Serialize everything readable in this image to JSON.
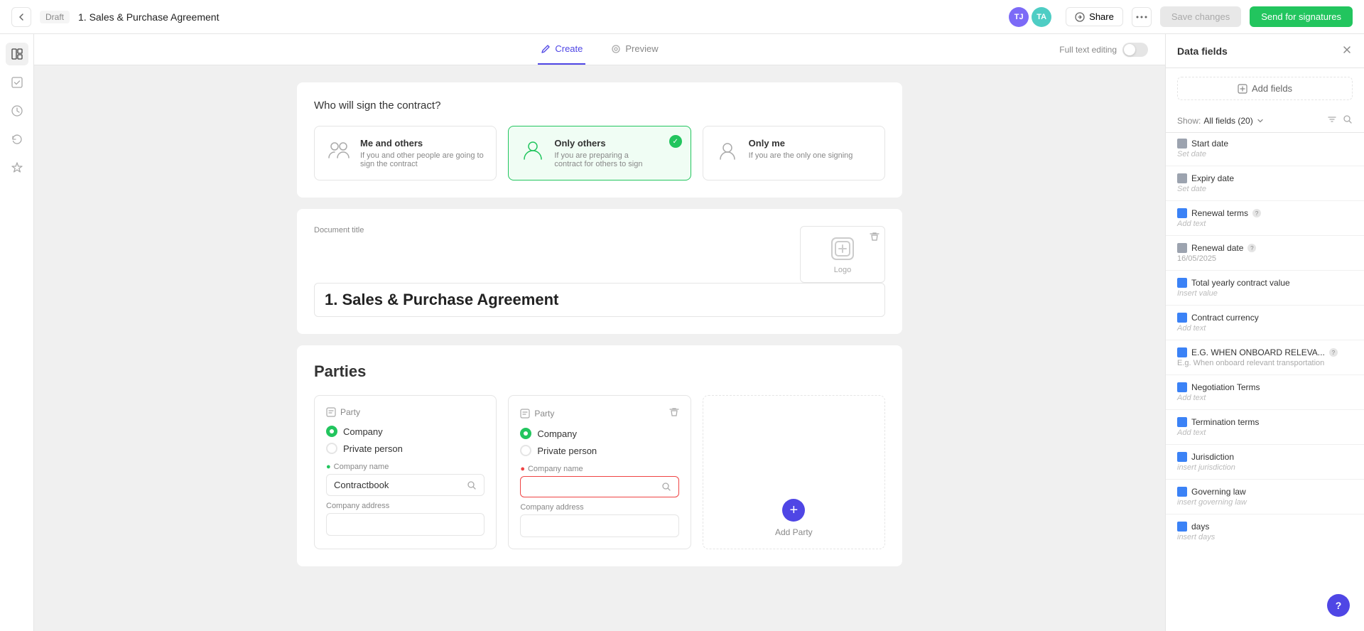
{
  "topbar": {
    "back_label": "←",
    "draft_label": "Draft",
    "title": "1. Sales & Purchase Agreement",
    "avatar1_initials": "TJ",
    "avatar2_initials": "TA",
    "share_label": "Share",
    "save_label": "Save changes",
    "send_label": "Send for signatures"
  },
  "tabs": {
    "create_label": "Create",
    "preview_label": "Preview",
    "full_text_label": "Full text editing"
  },
  "sign_section": {
    "question": "Who will sign the contract?",
    "option1_title": "Me and others",
    "option1_desc": "If you and other people are going to sign the contract",
    "option2_title": "Only others",
    "option2_desc": "If you are preparing a contract for others to sign",
    "option3_title": "Only me",
    "option3_desc": "If you are the only one signing"
  },
  "document": {
    "title_label": "Document title",
    "title_value": "1. Sales & Purchase Agreement",
    "logo_label": "Logo"
  },
  "parties": {
    "heading": "Parties",
    "party1": {
      "label": "Party",
      "company_label": "Company",
      "private_label": "Private person",
      "company_name_label": "Company name",
      "company_name_value": "Contractbook",
      "address_label": "Company address"
    },
    "party2": {
      "label": "Party",
      "company_label": "Company",
      "private_label": "Private person",
      "company_name_label": "Company name",
      "company_name_value": "",
      "address_label": "Company address"
    },
    "add_party_label": "Add Party"
  },
  "right_panel": {
    "title": "Data fields",
    "add_fields_label": "Add fields",
    "show_label": "Show:",
    "filter_label": "All fields (20)",
    "fields": [
      {
        "name": "Start date",
        "value": "Set date",
        "icon": "gray",
        "is_placeholder": true
      },
      {
        "name": "Expiry date",
        "value": "Set date",
        "icon": "gray",
        "is_placeholder": true
      },
      {
        "name": "Renewal terms",
        "value": "Add text",
        "icon": "blue",
        "is_placeholder": true,
        "has_help": true
      },
      {
        "name": "Renewal date",
        "value": "16/05/2025",
        "icon": "gray",
        "is_placeholder": false,
        "has_help": true
      },
      {
        "name": "Total yearly contract value",
        "value": "Insert value",
        "icon": "blue",
        "is_placeholder": true
      },
      {
        "name": "Contract currency",
        "value": "Add text",
        "icon": "blue",
        "is_placeholder": true
      },
      {
        "name": "E.G. WHEN ONBOARD RELEVA...",
        "value": "E.g. When onboard relevant transportation",
        "icon": "blue",
        "is_placeholder": false,
        "has_help": true
      },
      {
        "name": "Negotiation Terms",
        "value": "Add text",
        "icon": "blue",
        "is_placeholder": true
      },
      {
        "name": "Termination terms",
        "value": "Add text",
        "icon": "blue",
        "is_placeholder": true
      },
      {
        "name": "Jurisdiction",
        "value": "insert jurisdiction",
        "icon": "blue",
        "is_placeholder": true
      },
      {
        "name": "Governing law",
        "value": "insert governing law",
        "icon": "blue",
        "is_placeholder": true
      },
      {
        "name": "days",
        "value": "insert days",
        "icon": "blue",
        "is_placeholder": true
      }
    ]
  }
}
